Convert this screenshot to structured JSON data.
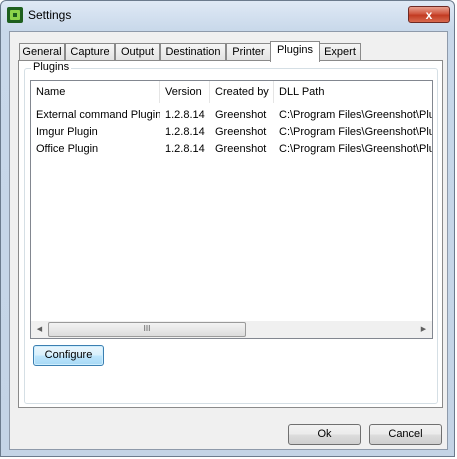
{
  "window": {
    "title": "Settings"
  },
  "tabs": [
    {
      "label": "General"
    },
    {
      "label": "Capture"
    },
    {
      "label": "Output"
    },
    {
      "label": "Destination"
    },
    {
      "label": "Printer"
    },
    {
      "label": "Plugins"
    },
    {
      "label": "Expert"
    }
  ],
  "active_tab": "Plugins",
  "group": {
    "label": "Plugins"
  },
  "plugins_table": {
    "columns": [
      "Name",
      "Version",
      "Created by",
      "DLL Path"
    ],
    "rows": [
      [
        "External command Plugin",
        "1.2.8.14",
        "Greenshot",
        "C:\\Program Files\\Greenshot\\Plugins\\"
      ],
      [
        "Imgur Plugin",
        "1.2.8.14",
        "Greenshot",
        "C:\\Program Files\\Greenshot\\Plugins\\"
      ],
      [
        "Office Plugin",
        "1.2.8.14",
        "Greenshot",
        "C:\\Program Files\\Greenshot\\Plugins\\"
      ]
    ],
    "scroll_thumb_grip": "III"
  },
  "buttons": {
    "configure": "Configure",
    "ok": "Ok",
    "cancel": "Cancel",
    "close": "x"
  },
  "colors": {
    "accent": "#3c7fb1",
    "close_button": "#c23b22"
  }
}
